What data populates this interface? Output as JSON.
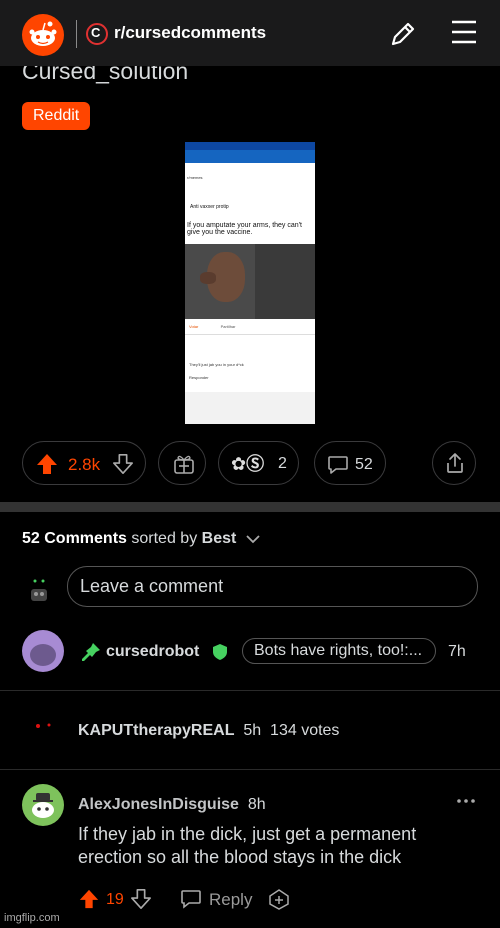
{
  "header": {
    "subreddit": "r/cursedcomments",
    "subreddit_icon_letter": "C"
  },
  "post": {
    "title": "Cursed_solution",
    "flair": "Reddit",
    "embedded_image": {
      "caption_title": "Anti vaxxer protip",
      "caption_text": "If you amputate your arms, they can't give you the vaccine.",
      "header_text": "r/memes",
      "comment_text": "They'll just jab you in your d*ck",
      "action_vote": "Votar",
      "action_share": "Partilhar",
      "action_reply": "Responder"
    },
    "votes": "2.8k",
    "awards_count": "2",
    "comments_count": "52"
  },
  "comments_section": {
    "count_label": "52 Comments",
    "sorted_by": "sorted by",
    "sort_value": "Best",
    "input_placeholder": "Leave a comment"
  },
  "comments": [
    {
      "author": "cursedrobot",
      "flair": "Bots have rights, too!:...",
      "time": "7h"
    },
    {
      "author": "KAPUTtherapyREAL",
      "time": "5h",
      "votes": "134 votes"
    },
    {
      "author": "AlexJonesInDisguise",
      "time": "8h",
      "body": "If they jab in the dick, just get a permanent erection so all the blood stays in the dick",
      "score": "19",
      "reply_label": "Reply"
    }
  ],
  "watermark": "imgflip.com",
  "colors": {
    "accent": "#ff4500",
    "background": "#000000",
    "header_bg": "#1a1a1b",
    "mod_green": "#46d160"
  }
}
